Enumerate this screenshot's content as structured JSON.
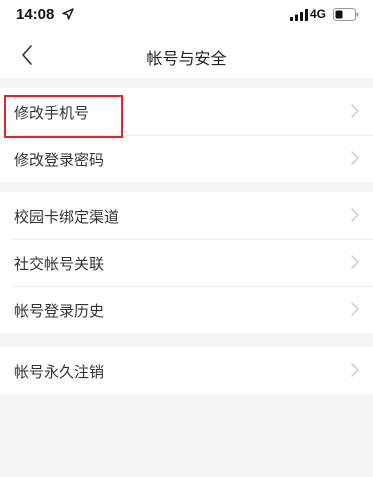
{
  "status_bar": {
    "time": "14:08",
    "network": "4G",
    "icons": [
      "location-arrow-icon",
      "signal-bars-icon",
      "battery-icon"
    ]
  },
  "header": {
    "title": "帐号与安全",
    "back_icon": "chevron-left-icon"
  },
  "groups": [
    {
      "items": [
        {
          "label": "修改手机号"
        },
        {
          "label": "修改登录密码"
        }
      ]
    },
    {
      "items": [
        {
          "label": "校园卡绑定渠道"
        },
        {
          "label": "社交帐号关联"
        },
        {
          "label": "帐号登录历史"
        }
      ]
    },
    {
      "items": [
        {
          "label": "帐号永久注销"
        }
      ]
    }
  ],
  "colors": {
    "background": "#f4f4f6",
    "row_background": "#ffffff",
    "highlight": "#e8222c",
    "chevron": "#c7c7cc"
  }
}
